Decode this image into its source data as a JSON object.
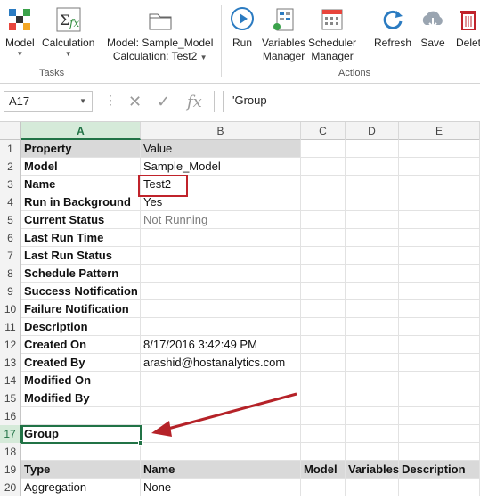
{
  "ribbon": {
    "tasks_group": "Tasks",
    "actions_group": "Actions",
    "model_btn": "Model",
    "calculation_btn": "Calculation",
    "context_model": "Model: Sample_Model",
    "context_calc": "Calculation: Test2",
    "run_btn": "Run",
    "variables_btn_l1": "Variables",
    "variables_btn_l2": "Manager",
    "scheduler_btn_l1": "Scheduler",
    "scheduler_btn_l2": "Manager",
    "refresh_btn": "Refresh",
    "save_btn": "Save",
    "delete_btn": "Delet"
  },
  "formula_bar": {
    "name_box": "A17",
    "formula": "'Group"
  },
  "columns": [
    "A",
    "B",
    "C",
    "D",
    "E"
  ],
  "rows": [
    {
      "n": "1",
      "a": "Property",
      "b": "Value"
    },
    {
      "n": "2",
      "a": "Model",
      "b": "Sample_Model"
    },
    {
      "n": "3",
      "a": "Name",
      "b": "Test2"
    },
    {
      "n": "4",
      "a": "Run in Background",
      "b": "Yes"
    },
    {
      "n": "5",
      "a": "Current Status",
      "b": "Not Running"
    },
    {
      "n": "6",
      "a": "Last Run Time",
      "b": ""
    },
    {
      "n": "7",
      "a": "Last Run Status",
      "b": ""
    },
    {
      "n": "8",
      "a": "Schedule Pattern",
      "b": ""
    },
    {
      "n": "9",
      "a": "Success Notification",
      "b": ""
    },
    {
      "n": "10",
      "a": "Failure Notification",
      "b": ""
    },
    {
      "n": "11",
      "a": "Description",
      "b": ""
    },
    {
      "n": "12",
      "a": "Created On",
      "b": "8/17/2016 3:42:49 PM"
    },
    {
      "n": "13",
      "a": "Created By",
      "b": "arashid@hostanalytics.com"
    },
    {
      "n": "14",
      "a": "Modified On",
      "b": ""
    },
    {
      "n": "15",
      "a": "Modified By",
      "b": ""
    },
    {
      "n": "16",
      "a": "",
      "b": ""
    },
    {
      "n": "17",
      "a": "Group",
      "b": ""
    },
    {
      "n": "18",
      "a": "",
      "b": ""
    },
    {
      "n": "19",
      "a": "Type",
      "b": "Name",
      "c": "Model",
      "d": "Variables",
      "e": "Description"
    },
    {
      "n": "20",
      "a": "Aggregation",
      "b": "None"
    }
  ],
  "colors": {
    "excel_green": "#217346",
    "header_shade": "#d9d9d9",
    "annotation_red": "#c0232b"
  }
}
